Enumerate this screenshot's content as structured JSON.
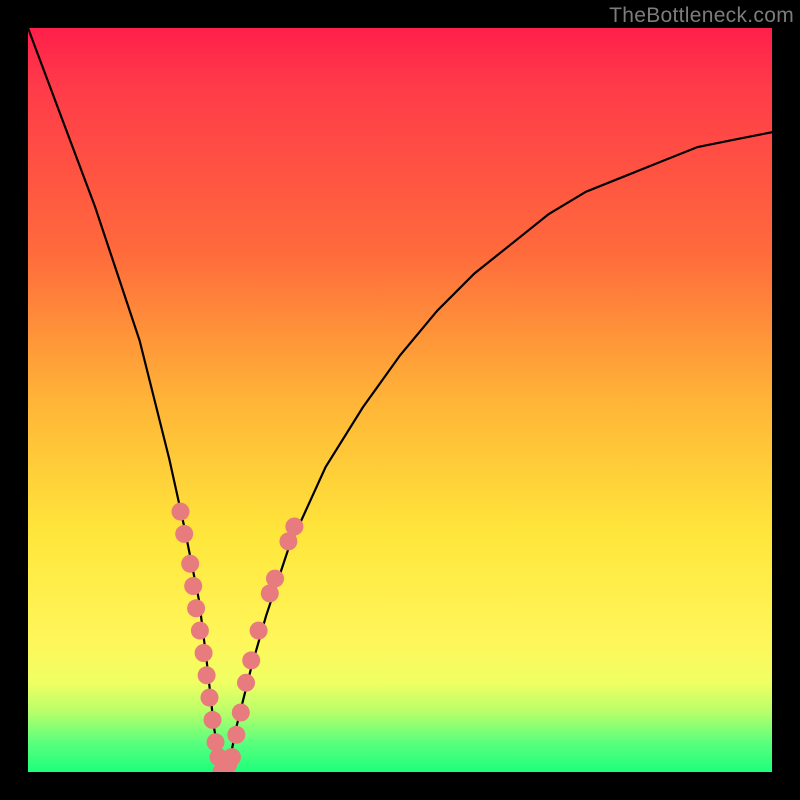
{
  "watermark": "TheBottleneck.com",
  "colors": {
    "curve_stroke": "#000000",
    "dot_fill": "#e77b7d",
    "gradient_stops": [
      "#ff1f4a",
      "#ff6a3c",
      "#ffe63b",
      "#1dff7c"
    ]
  },
  "chart_data": {
    "type": "line",
    "title": "",
    "xlabel": "",
    "ylabel": "",
    "xlim": [
      0,
      100
    ],
    "ylim": [
      0,
      100
    ],
    "grid": false,
    "series_note": "V-shaped bottleneck curve; y is bottleneck % vs. normalized x. Minimum ~0 at x≈26.",
    "series": [
      {
        "name": "bottleneck-curve",
        "x": [
          0,
          3,
          6,
          9,
          12,
          15,
          17,
          19,
          21,
          23,
          24,
          25,
          26,
          27,
          28,
          30,
          32,
          35,
          40,
          45,
          50,
          55,
          60,
          65,
          70,
          75,
          80,
          85,
          90,
          95,
          100
        ],
        "values": [
          100,
          92,
          84,
          76,
          67,
          58,
          50,
          42,
          33,
          23,
          15,
          6,
          0,
          1,
          6,
          14,
          21,
          30,
          41,
          49,
          56,
          62,
          67,
          71,
          75,
          78,
          80,
          82,
          84,
          85,
          86
        ]
      }
    ],
    "dots_note": "Highlighted sample points near the minimum of the curve (salmon dots).",
    "dots": [
      {
        "x": 20.5,
        "y": 35
      },
      {
        "x": 21.0,
        "y": 32
      },
      {
        "x": 21.8,
        "y": 28
      },
      {
        "x": 22.2,
        "y": 25
      },
      {
        "x": 22.6,
        "y": 22
      },
      {
        "x": 23.1,
        "y": 19
      },
      {
        "x": 23.6,
        "y": 16
      },
      {
        "x": 24.0,
        "y": 13
      },
      {
        "x": 24.4,
        "y": 10
      },
      {
        "x": 24.8,
        "y": 7
      },
      {
        "x": 25.2,
        "y": 4
      },
      {
        "x": 25.6,
        "y": 2
      },
      {
        "x": 26.0,
        "y": 0
      },
      {
        "x": 26.4,
        "y": 0
      },
      {
        "x": 26.9,
        "y": 1
      },
      {
        "x": 27.4,
        "y": 2
      },
      {
        "x": 28.0,
        "y": 5
      },
      {
        "x": 28.6,
        "y": 8
      },
      {
        "x": 29.3,
        "y": 12
      },
      {
        "x": 30.0,
        "y": 15
      },
      {
        "x": 31.0,
        "y": 19
      },
      {
        "x": 32.5,
        "y": 24
      },
      {
        "x": 33.2,
        "y": 26
      },
      {
        "x": 35.0,
        "y": 31
      },
      {
        "x": 35.8,
        "y": 33
      }
    ]
  }
}
